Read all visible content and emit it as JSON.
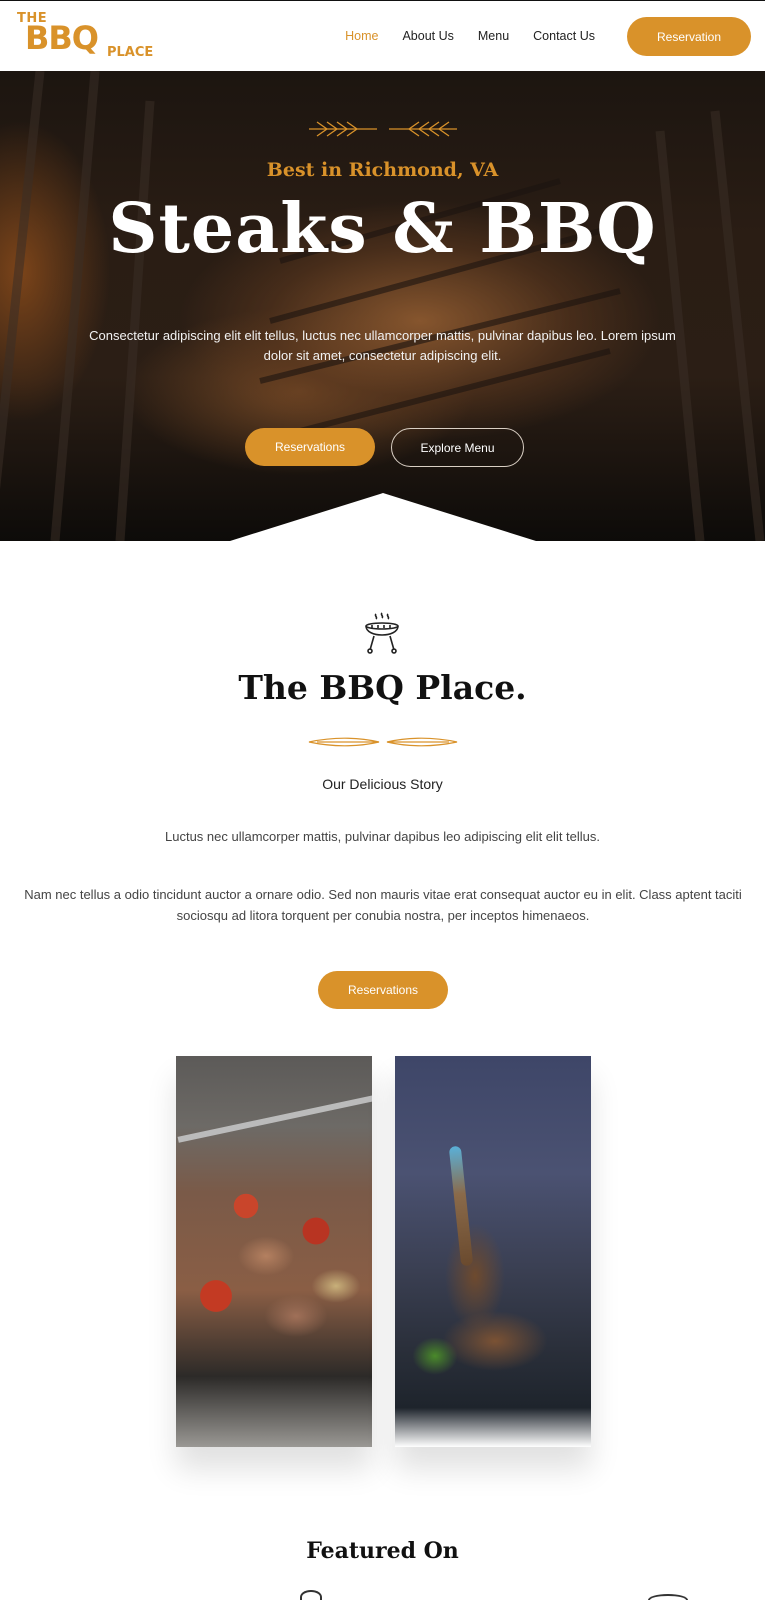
{
  "header": {
    "logo": {
      "the": "THE",
      "bbq": "BBQ",
      "place": "PLACE"
    },
    "nav": [
      {
        "label": "Home",
        "active": true
      },
      {
        "label": "About Us",
        "active": false
      },
      {
        "label": "Menu",
        "active": false
      },
      {
        "label": "Contact Us",
        "active": false
      }
    ],
    "reservation_label": "Reservation"
  },
  "hero": {
    "eyebrow": "Best in Richmond, VA",
    "title": "Steaks & BBQ",
    "description": "Consectetur adipiscing elit elit tellus, luctus nec ullamcorper mattis, pulvinar dapibus leo. Lorem ipsum dolor sit amet, consectetur adipiscing elit.",
    "primary_button": "Reservations",
    "secondary_button": "Explore Menu"
  },
  "story": {
    "icon": "grill-icon",
    "title": "The BBQ Place.",
    "subtitle": "Our Delicious Story",
    "paragraph1": "Luctus nec ullamcorper mattis, pulvinar dapibus leo adipiscing elit elit tellus.",
    "paragraph2": "Nam nec tellus a odio tincidunt auctor a ornare odio. Sed non mauris vitae erat consequat auctor eu in elit. Class aptent taciti sociosqu ad litora torquent per conubia nostra, per inceptos himenaeos.",
    "button": "Reservations"
  },
  "featured": {
    "title": "Featured On"
  },
  "colors": {
    "accent": "#d9922a",
    "dark": "#111111",
    "white": "#ffffff"
  }
}
